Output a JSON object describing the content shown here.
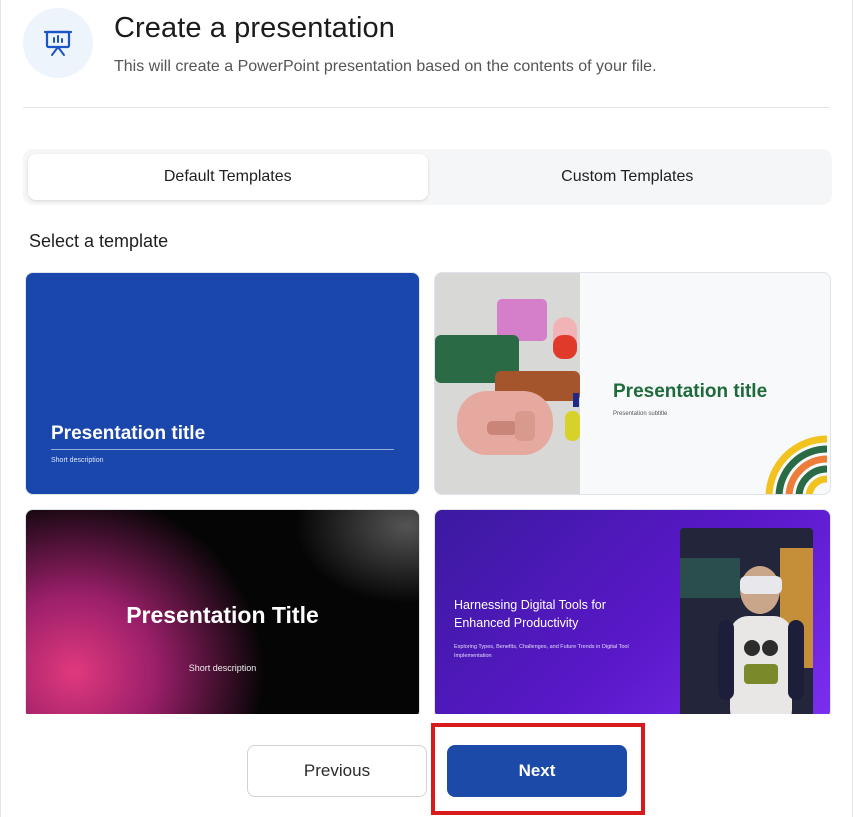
{
  "header": {
    "icon": "presentation-board-icon",
    "title": "Create a presentation",
    "subtitle": "This will create a PowerPoint presentation based on the contents of your file."
  },
  "tabs": [
    {
      "label": "Default Templates",
      "active": true
    },
    {
      "label": "Custom Templates",
      "active": false
    }
  ],
  "section_label": "Select a template",
  "templates": [
    {
      "title": "Presentation title",
      "description": "Short description",
      "background": "#1a47ab"
    },
    {
      "title": "Presentation title",
      "description": "Presentation subtitle",
      "accent": "#1e6a3a"
    },
    {
      "title": "Presentation Title",
      "description": "Short description",
      "background": "#050505"
    },
    {
      "title": "Harnessing Digital Tools for Enhanced Productivity",
      "description": "Exploring Types, Benefits, Challenges, and Future Trends in Digital Tool Implementation",
      "background": "#5a18c9"
    }
  ],
  "footer": {
    "previous_label": "Previous",
    "next_label": "Next",
    "next_color": "#1c4aa8",
    "highlight_color": "#d71a1a"
  }
}
